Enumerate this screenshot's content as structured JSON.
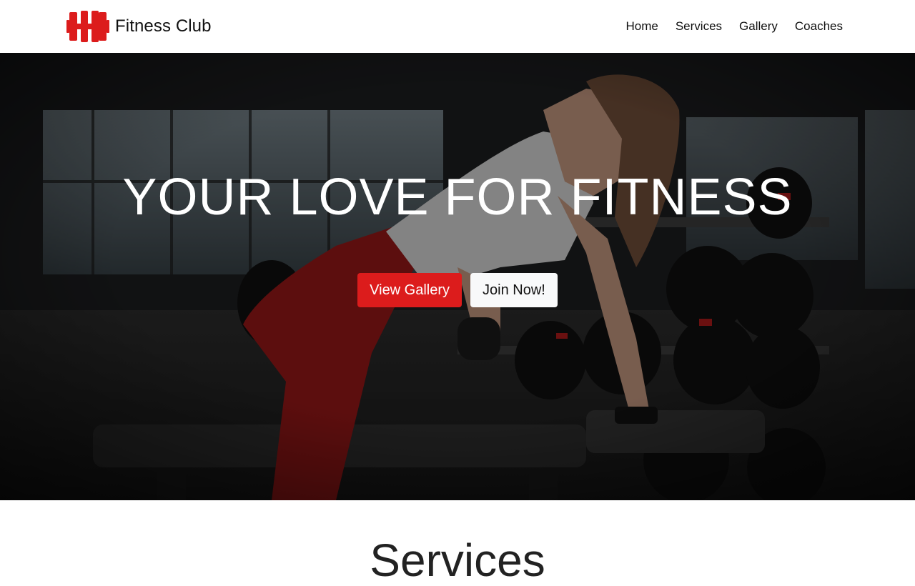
{
  "brand": {
    "name": "Fitness Club",
    "logo_icon": "dumbbell-icon",
    "accent_color": "#dc1c1c"
  },
  "nav": {
    "items": [
      {
        "label": "Home"
      },
      {
        "label": "Services"
      },
      {
        "label": "Gallery"
      },
      {
        "label": "Coaches"
      }
    ]
  },
  "hero": {
    "title": "YOUR LOVE FOR FITNESS",
    "primary_button": "View Gallery",
    "secondary_button": "Join Now!",
    "image": "woman-lifting-dumbbell-gym-photo"
  },
  "services": {
    "title": "Services"
  }
}
